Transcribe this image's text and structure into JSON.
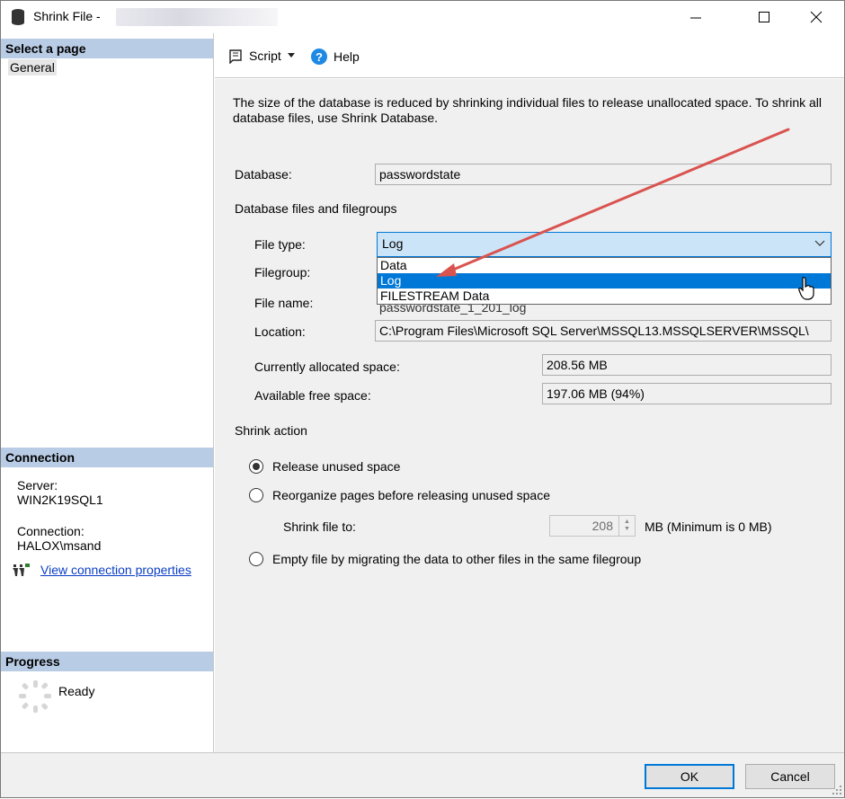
{
  "window": {
    "title": "Shrink File -"
  },
  "left_panel": {
    "select_page_header": "Select a page",
    "general_label": "General",
    "connection_header": "Connection",
    "server_label": "Server:",
    "server_value": "WIN2K19SQL1",
    "connection_label": "Connection:",
    "connection_value": "HALOX\\msand",
    "view_props_link": "View connection properties",
    "progress_header": "Progress",
    "progress_status": "Ready"
  },
  "toolbar": {
    "script_label": "Script",
    "help_label": "Help"
  },
  "main": {
    "description": "The size of the database is reduced by shrinking individual files to release unallocated space. To shrink all database files, use Shrink Database.",
    "database_label": "Database:",
    "database_value": "passwordstate",
    "files_group_label": "Database files and filegroups",
    "file_type_label": "File type:",
    "file_type_value": "Log",
    "file_type_options": [
      "Data",
      "Log",
      "FILESTREAM Data"
    ],
    "filegroup_label": "Filegroup:",
    "file_name_label": "File name:",
    "location_label": "Location:",
    "location_value": "C:\\Program Files\\Microsoft SQL Server\\MSSQL13.MSSQLSERVER\\MSSQL\\",
    "allocated_label": "Currently allocated space:",
    "allocated_value": "208.56 MB",
    "free_label": "Available free space:",
    "free_value": "197.06 MB (94%)",
    "shrink_action_label": "Shrink action",
    "option_release": "Release unused space",
    "option_reorganize": "Reorganize pages before releasing unused space",
    "shrink_to_label": "Shrink file to:",
    "shrink_to_value": "208",
    "shrink_unit": "MB (Minimum is 0 MB)",
    "option_empty": "Empty file by migrating the data to other files in the same filegroup"
  },
  "footer": {
    "ok_label": "OK",
    "cancel_label": "Cancel"
  },
  "colors": {
    "accent": "#0078d7",
    "header_bg": "#b9cce5",
    "arrow": "#d9534f",
    "link": "#0a3ec5"
  }
}
